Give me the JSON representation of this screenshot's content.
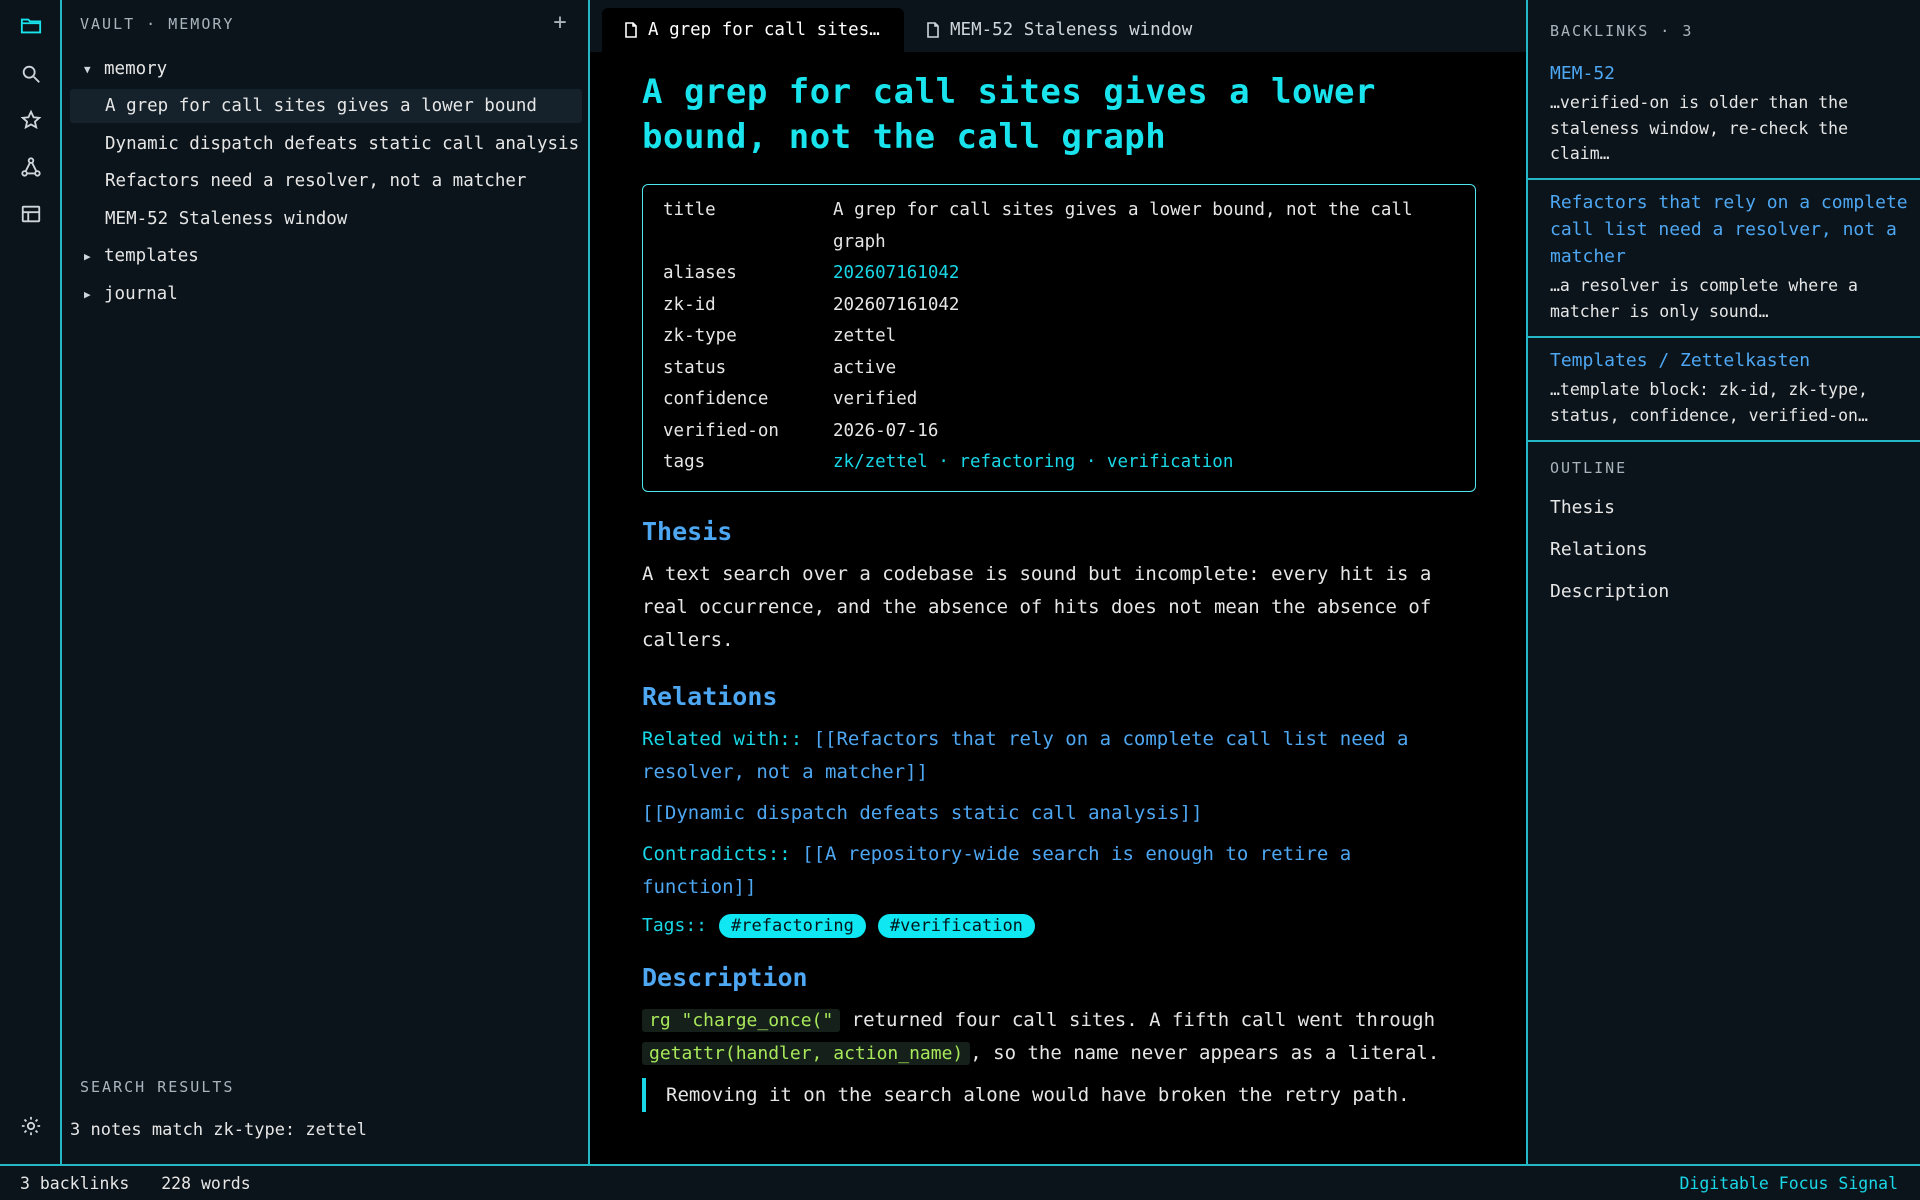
{
  "activity_bar": {
    "icons": [
      "folder-icon",
      "search-icon",
      "star-icon",
      "graph-icon",
      "table-icon",
      "settings-gear-icon"
    ]
  },
  "explorer": {
    "header": "VAULT · MEMORY",
    "add_label": "+",
    "tree": {
      "memory_folder": "memory",
      "files": [
        "A grep for call sites gives a lower bound",
        "Dynamic dispatch defeats static call analysis",
        "Refactors need a resolver, not a matcher",
        "MEM-52 Staleness window"
      ],
      "templates_folder": "templates",
      "journal_folder": "journal"
    },
    "search": {
      "header": "SEARCH RESULTS",
      "result": "3 notes match zk-type: zettel"
    }
  },
  "tabs": [
    {
      "label": "A grep for call sites…",
      "active": true
    },
    {
      "label": "MEM-52 Staleness window",
      "active": false
    }
  ],
  "note": {
    "title": "A grep for call sites gives a lower bound, not the call graph",
    "frontmatter": {
      "title_key": "title",
      "title_val": "A grep for call sites gives a lower bound, not the call graph",
      "aliases_key": "aliases",
      "aliases_val": "202607161042",
      "zkid_key": "zk-id",
      "zkid_val": "202607161042",
      "zktype_key": "zk-type",
      "zktype_val": "zettel",
      "status_key": "status",
      "status_val": "active",
      "confidence_key": "confidence",
      "confidence_val": "verified",
      "verified_key": "verified-on",
      "verified_val": "2026-07-16",
      "tags_key": "tags",
      "tags_val": "zk/zettel · refactoring · verification"
    },
    "thesis_heading": "Thesis",
    "thesis_text": "A text search over a codebase is sound but incomplete: every hit is a real occurrence, and the absence of hits does not mean the absence of callers.",
    "relations_heading": "Relations",
    "related_key": "Related with::",
    "related_link": "[[Refactors that rely on a complete call list need a resolver, not a matcher]]",
    "related_link2": "[[Dynamic dispatch defeats static call analysis]]",
    "contradicts_key": "Contradicts::",
    "contradicts_link": "[[A repository-wide search is enough to retire a function]]",
    "tags_key": "Tags::",
    "tags": [
      "#refactoring",
      "#verification"
    ],
    "description_heading": "Description",
    "desc_code1": "rg \"charge_once(\"",
    "desc_text1": " returned four call sites. A fifth call went through ",
    "desc_code2": "getattr(handler, action_name)",
    "desc_text2": ", so the name never appears as a literal.",
    "quote": "Removing it on the search alone would have broken the retry path."
  },
  "right_panel": {
    "backlinks_header": "BACKLINKS · 3",
    "backlinks": [
      {
        "title": "MEM-52",
        "snippet": "…verified-on is older than the staleness window, re-check the claim…"
      },
      {
        "title": "Refactors that rely on a complete call list need a resolver, not a matcher",
        "snippet": "…a resolver is complete where a matcher is only sound…"
      },
      {
        "title": "Templates / Zettelkasten",
        "snippet": "…template block: zk-id, zk-type, status, confidence, verified-on…"
      }
    ],
    "outline_header": "OUTLINE",
    "outline": [
      "Thesis",
      "Relations",
      "Description"
    ]
  },
  "status_bar": {
    "backlinks": "3 backlinks",
    "words": "228 words",
    "theme": "Digitable Focus Signal"
  },
  "colors": {
    "accent_cyan": "#19e3ec",
    "link_blue": "#4ea7f2",
    "border": "#24b8c6",
    "panel_bg": "#0b141b",
    "code_green": "#a8e85a"
  }
}
